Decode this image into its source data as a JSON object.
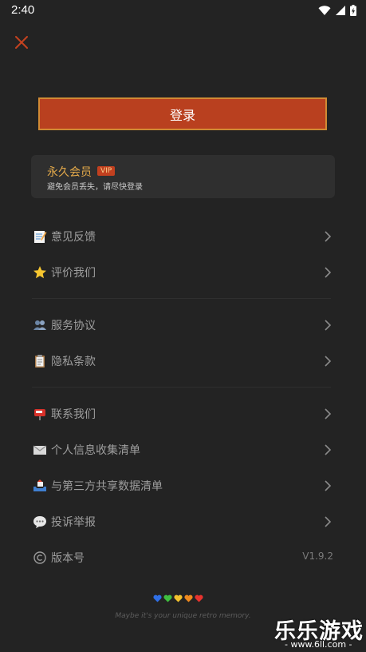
{
  "status_bar": {
    "time": "2:40"
  },
  "login": {
    "button_label": "登录"
  },
  "vip": {
    "title": "永久会员",
    "badge": "VIP",
    "subtitle": "避免会员丢失，请尽快登录"
  },
  "menu": {
    "feedback": {
      "label": "意见反馈",
      "icon": "memo-icon"
    },
    "rate": {
      "label": "评价我们",
      "icon": "star-icon"
    },
    "terms": {
      "label": "服务协议",
      "icon": "people-icon"
    },
    "privacy": {
      "label": "隐私条款",
      "icon": "clipboard-icon"
    },
    "contact": {
      "label": "联系我们",
      "icon": "postbox-icon"
    },
    "personal_info": {
      "label": "个人信息收集清单",
      "icon": "envelope-icon"
    },
    "third_party": {
      "label": "与第三方共享数据清单",
      "icon": "outbox-tray-icon"
    },
    "report": {
      "label": "投诉举报",
      "icon": "speech-bubble-icon"
    },
    "version": {
      "label": "版本号",
      "value": "V1.9.2",
      "icon": "copyright-icon"
    }
  },
  "footer": {
    "hearts": [
      "#2f6fe6",
      "#3fbf3f",
      "#f2c12e",
      "#f08a1e",
      "#e8332e"
    ],
    "tagline": "Maybe it's your unique retro memory."
  },
  "watermark": {
    "title": "乐乐游戏",
    "url": "- www.6ll.com -"
  },
  "colors": {
    "background": "#232323",
    "accent": "#b9401f",
    "accent_border": "#d08a34",
    "vip_gold": "#e3a94a"
  }
}
